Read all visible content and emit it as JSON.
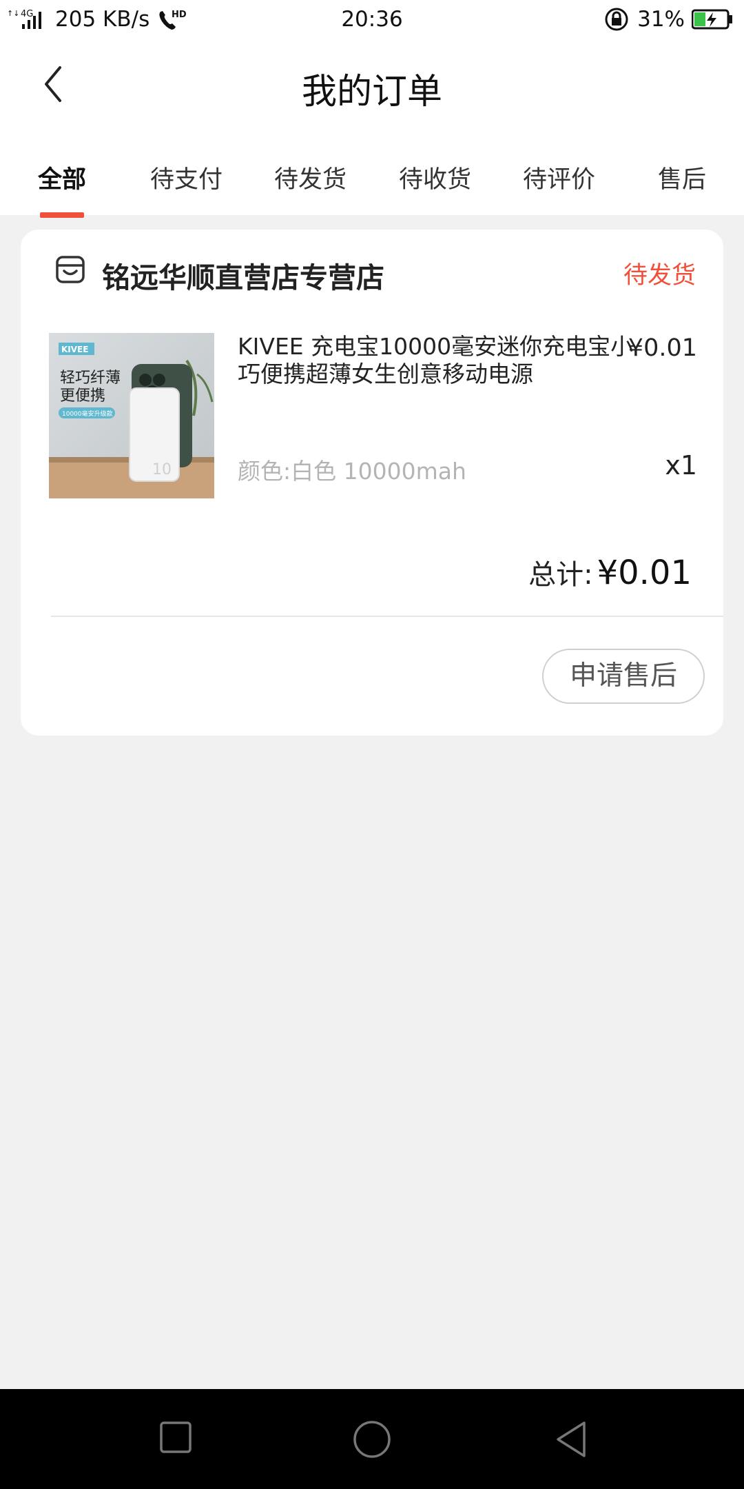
{
  "status_bar": {
    "network": "4G",
    "speed": "205 KB/s",
    "call": "HD",
    "time": "20:36",
    "battery": "31%"
  },
  "header": {
    "title": "我的订单",
    "back_icon": "back-arrow-icon"
  },
  "tabs": [
    {
      "label": "全部",
      "active": true
    },
    {
      "label": "待支付"
    },
    {
      "label": "待发货"
    },
    {
      "label": "待收货"
    },
    {
      "label": "待评价"
    },
    {
      "label": "售后"
    }
  ],
  "order": {
    "shop_name": "铭远华顺直营店专营店",
    "status": "待发货",
    "product": {
      "name": "KIVEE 充电宝10000毫安迷你充电宝小巧便携超薄女生创意移动电源",
      "price": "¥0.01",
      "variant": "颜色:白色 10000mah",
      "quantity": "x1",
      "image": {
        "brand": "KIVEE",
        "line1": "轻巧纤薄",
        "line2": "更便携",
        "badge": "10000毫安升级款"
      }
    },
    "total_label": "总计:",
    "total_value": "¥0.01",
    "action_button": "申请售后"
  },
  "colors": {
    "accent": "#f0503a",
    "background": "#f1f1f1",
    "card": "#ffffff"
  }
}
